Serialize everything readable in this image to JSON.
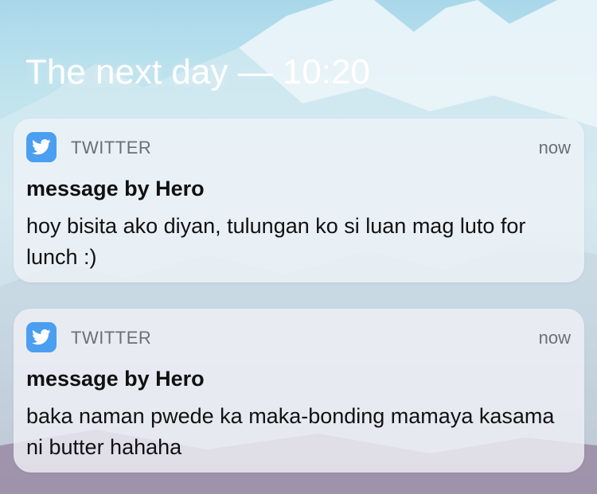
{
  "header": {
    "text": "The next day — 10:20"
  },
  "notifications": [
    {
      "app_name": "TWITTER",
      "app_icon": "twitter-bird-icon",
      "time": "now",
      "title": "message by Hero",
      "body": "hoy bisita ako diyan, tulungan ko si luan mag luto for lunch :)"
    },
    {
      "app_name": "TWITTER",
      "app_icon": "twitter-bird-icon",
      "time": "now",
      "title": "message by Hero",
      "body": "baka naman pwede ka maka-bonding mamaya kasama ni butter hahaha"
    }
  ],
  "colors": {
    "app_icon_bg": "#4a9ff1",
    "heading": "#ffffff",
    "meta_text": "#6b6f76"
  }
}
